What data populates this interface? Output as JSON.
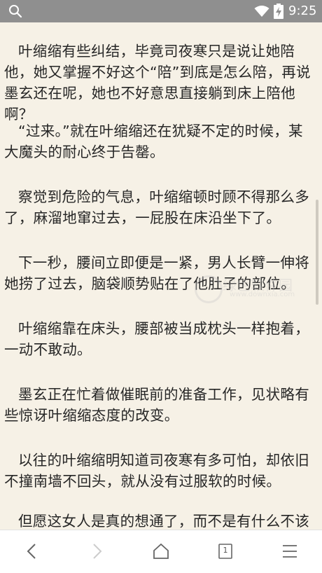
{
  "status_bar": {
    "time": "9:25",
    "icons": [
      "search-icon",
      "wifi-icon",
      "battery-charging-icon"
    ]
  },
  "article": {
    "paragraphs": [
      "叶缩缩有些纠结，毕竟司夜寒只是说让她陪他，她又掌握不好这个“陪”到底是怎么陪，再说墨玄还在呢，她也不好意思直接躺到床上陪他啊？",
      "“过来。”就在叶缩缩还在犹疑不定的时候，某大魔头的耐心终于告罄。",
      "察觉到危险的气息，叶缩缩顿时顾不得那么多了，麻溜地窜过去，一屁股在床沿坐下了。",
      "下一秒，腰间立即便是一紧，男人长臂一伸将她捞了过去，脑袋顺势贴在了他肚子的部位。",
      "叶缩缩靠在床头，腰部被当成枕头一样抱着，一动不敢动。",
      "墨玄正在忙着做催眠前的准备工作，见状略有些惊讶叶缩缩态度的改变。",
      "以往的叶缩缩明知道司夜寒有多可怕，却依旧不撞南墙不回头，就从没有过服软的时候。",
      "但愿这女人是真的想通了，而不是有什么不该"
    ]
  },
  "watermark": {
    "text": "绿色软件园",
    "url": "www.downxia.com"
  },
  "bottom_nav": {
    "tab_count": "1",
    "icons": [
      "back-icon",
      "forward-icon",
      "home-icon",
      "tabs-icon",
      "menu-icon"
    ]
  },
  "colors": {
    "page_background": "#f6f1e6",
    "status_bar": "#8f8f8f",
    "text": "#262626",
    "nav_icon": "#666666",
    "nav_icon_disabled": "#cccccc"
  }
}
